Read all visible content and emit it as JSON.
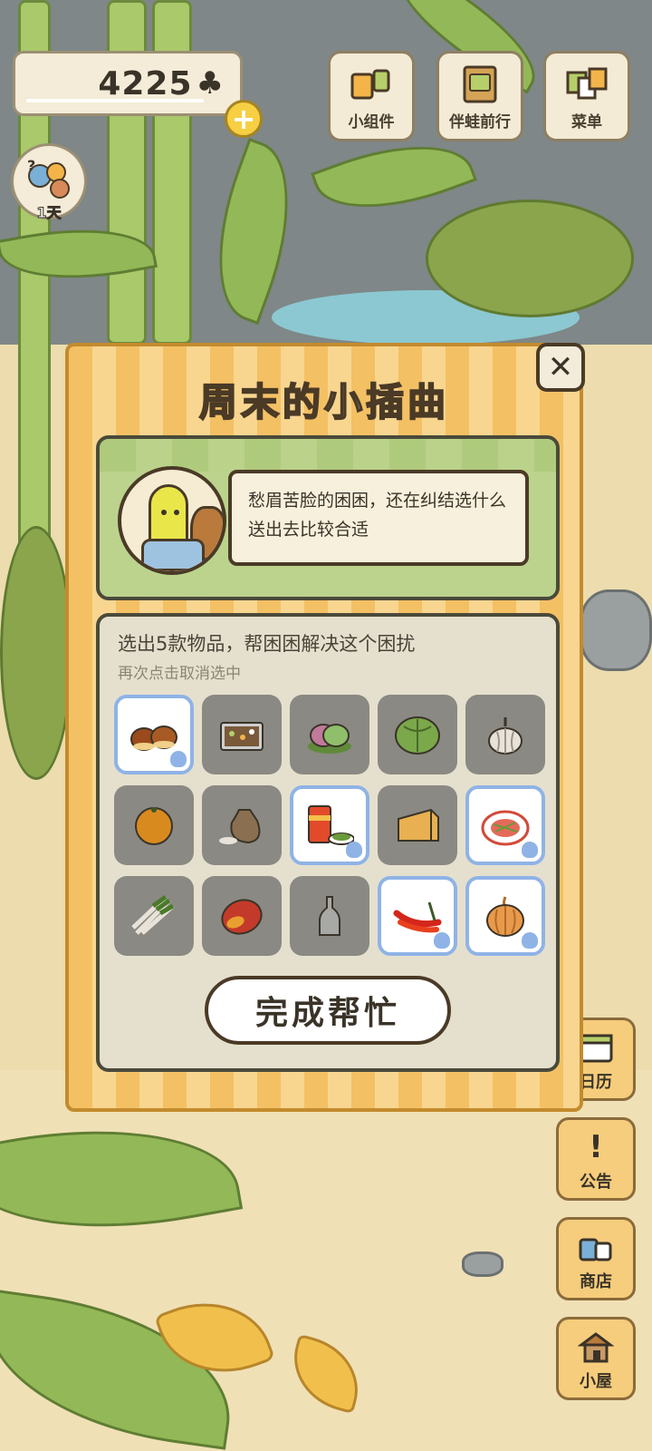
{
  "hud": {
    "clover_count": "4225",
    "clover_icon": "clover-icon",
    "plus_label": "+",
    "avatar_day": "1天",
    "buttons": [
      {
        "label": "小组件",
        "icon": "widget-icon"
      },
      {
        "label": "伴蛙前行",
        "icon": "journal-icon"
      },
      {
        "label": "菜单",
        "icon": "menu-cards-icon"
      }
    ]
  },
  "side_buttons": [
    {
      "label": "日历",
      "icon": "calendar-icon",
      "glyph": ""
    },
    {
      "label": "公告",
      "icon": "exclamation-icon",
      "glyph": "!"
    },
    {
      "label": "商店",
      "icon": "shop-bags-icon",
      "glyph": ""
    },
    {
      "label": "小屋",
      "icon": "house-icon",
      "glyph": ""
    }
  ],
  "dialog": {
    "title": "周末的小插曲",
    "close_label": "✕",
    "story_text": "愁眉苦脸的困困，还在纠结选什么送出去比较合适",
    "instruction": "选出5款物品，帮困困解决这个困扰",
    "sub_instruction": "再次点击取消选中",
    "done_button": "完成帮忙",
    "items": [
      {
        "name": "chestnuts",
        "selected": true
      },
      {
        "name": "bento-box",
        "selected": false
      },
      {
        "name": "rice-cakes",
        "selected": false
      },
      {
        "name": "cabbage",
        "selected": false
      },
      {
        "name": "garlic",
        "selected": false
      },
      {
        "name": "orange",
        "selected": false
      },
      {
        "name": "rice-sack",
        "selected": false
      },
      {
        "name": "canned-food",
        "selected": true
      },
      {
        "name": "cheese",
        "selected": false
      },
      {
        "name": "salad-plate",
        "selected": true
      },
      {
        "name": "green-onion",
        "selected": false
      },
      {
        "name": "mango",
        "selected": false
      },
      {
        "name": "glass-bottle",
        "selected": false
      },
      {
        "name": "chili-peppers",
        "selected": true
      },
      {
        "name": "onion",
        "selected": true
      }
    ]
  },
  "colors": {
    "accent_orange": "#f4c064",
    "selected_border": "#8fb3e6",
    "unselected_cell": "#8a8983"
  }
}
